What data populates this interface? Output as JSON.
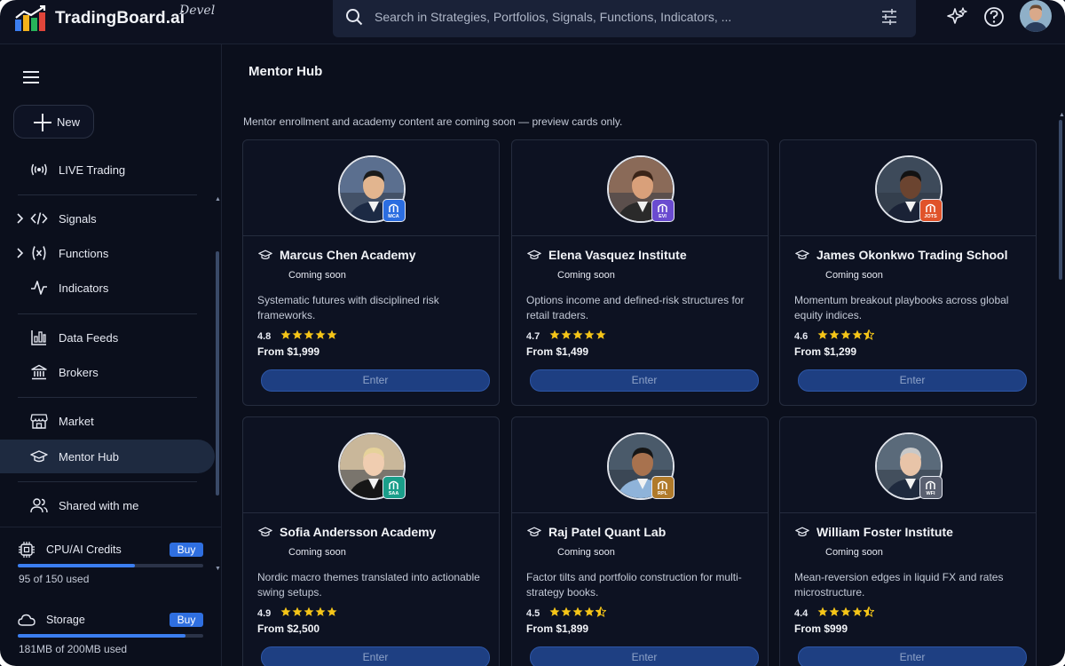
{
  "header": {
    "brand": "TradingBoard.ai",
    "env": "Devel",
    "search_placeholder": "Search in Strategies, Portfolios, Signals, Functions, Indicators, ..."
  },
  "sidebar": {
    "new_label": "New",
    "items": [
      {
        "label": "LIVE Trading",
        "icon": "broadcast-icon"
      },
      {
        "label": "Signals",
        "icon": "code-icon"
      },
      {
        "label": "Functions",
        "icon": "function-icon"
      },
      {
        "label": "Indicators",
        "icon": "pulse-icon"
      },
      {
        "label": "Data Feeds",
        "icon": "chart-icon"
      },
      {
        "label": "Brokers",
        "icon": "bank-icon"
      },
      {
        "label": "Market",
        "icon": "store-icon"
      },
      {
        "label": "Mentor Hub",
        "icon": "graduation-cap-icon"
      },
      {
        "label": "Shared with me",
        "icon": "users-icon"
      }
    ],
    "credits": {
      "label": "CPU/AI Credits",
      "buy": "Buy",
      "used_text": "95 of 150 used",
      "fraction": 0.633
    },
    "storage": {
      "label": "Storage",
      "buy": "Buy",
      "used_text": "181MB of 200MB used",
      "fraction": 0.905
    }
  },
  "main": {
    "title": "Mentor Hub",
    "notice": "Mentor enrollment and academy content are coming soon — preview cards only.",
    "status": "Coming soon",
    "enter_label": "Enter",
    "cards": [
      {
        "name": "Marcus Chen Academy",
        "badge": "MCA",
        "desc": "Systematic futures with disciplined risk frameworks.",
        "rating": "4.8",
        "stars": 5,
        "price": "From $1,999",
        "badge_color": "#2b6de0",
        "accent": "#5b6f8f"
      },
      {
        "name": "Elena Vasquez Institute",
        "badge": "EVI",
        "desc": "Options income and defined-risk structures for retail traders.",
        "rating": "4.7",
        "stars": 5,
        "price": "From $1,499",
        "badge_color": "#6a4bd0",
        "accent": "#8a6a58"
      },
      {
        "name": "James Okonkwo Trading School",
        "badge": "JOTS",
        "desc": "Momentum breakout playbooks across global equity indices.",
        "rating": "4.6",
        "stars": 4.5,
        "price": "From $1,299",
        "badge_color": "#e0532a",
        "accent": "#3d4a5a"
      },
      {
        "name": "Sofia Andersson Academy",
        "badge": "SAA",
        "desc": "Nordic macro themes translated into actionable swing setups.",
        "rating": "4.9",
        "stars": 5,
        "price": "From $2,500",
        "badge_color": "#1a9e8a",
        "accent": "#c9b79a"
      },
      {
        "name": "Raj Patel Quant Lab",
        "badge": "RPL",
        "desc": "Factor tilts and portfolio construction for multi-strategy books.",
        "rating": "4.5",
        "stars": 4.5,
        "price": "From $1,899",
        "badge_color": "#b07a2a",
        "accent": "#4a5a6a"
      },
      {
        "name": "William Foster Institute",
        "badge": "WFI",
        "desc": "Mean-reversion edges in liquid FX and rates microstructure.",
        "rating": "4.4",
        "stars": 4.5,
        "price": "From $999",
        "badge_color": "#5a6070",
        "accent": "#5a6a7a"
      }
    ]
  }
}
